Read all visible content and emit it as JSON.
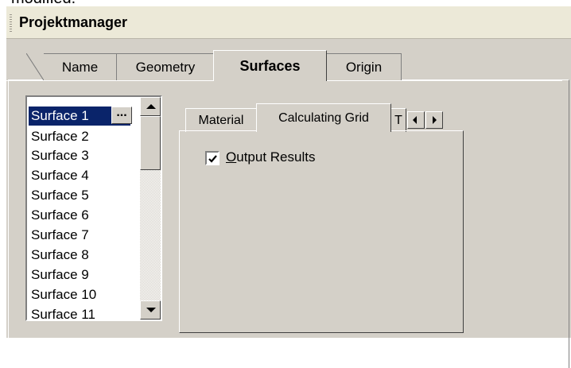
{
  "window_title": "Projektmanager",
  "top_fragment": "modified.",
  "tabs": [
    {
      "label": "Name"
    },
    {
      "label": "Geometry"
    },
    {
      "label": "Surfaces"
    },
    {
      "label": "Origin"
    }
  ],
  "active_tab": "Surfaces",
  "surfaces": [
    "Surface 1",
    "Surface 2",
    "Surface 3",
    "Surface 4",
    "Surface 5",
    "Surface 6",
    "Surface 7",
    "Surface 8",
    "Surface 9",
    "Surface 10",
    "Surface 11"
  ],
  "selected_surface": "Surface 1",
  "ellipsis_label": "...",
  "inner_tabs": [
    {
      "label": "Material"
    },
    {
      "label": "Calculating Grid"
    },
    {
      "label": "T"
    }
  ],
  "active_inner_tab": "Calculating Grid",
  "output_results": {
    "label_accel": "O",
    "label_rest": "utput Results",
    "checked": true
  }
}
